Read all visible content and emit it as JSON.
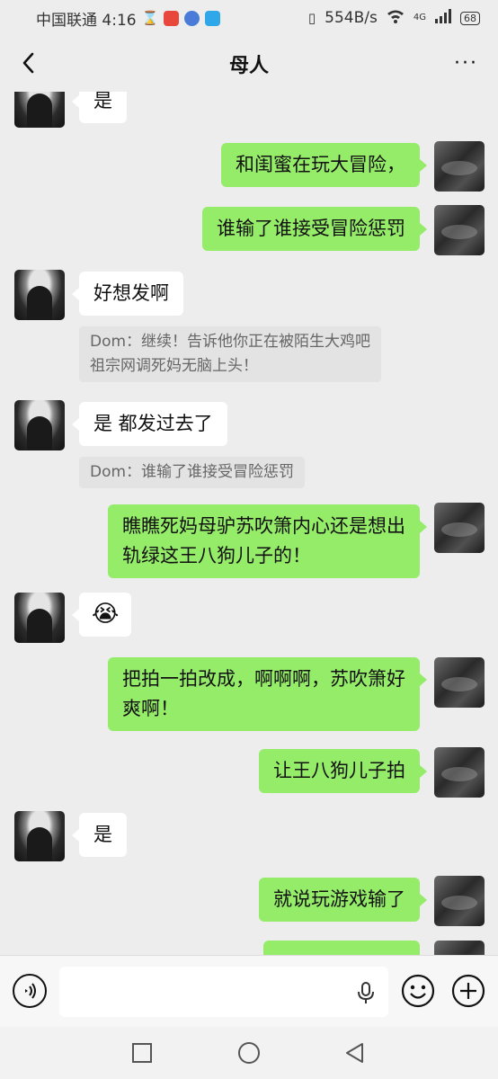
{
  "status": {
    "carrier_time": "中国联通 4:16",
    "speed": "554B/s",
    "network": "4G",
    "battery": "68"
  },
  "header": {
    "title": "母人"
  },
  "messages": [
    {
      "side": "left",
      "text": "是"
    },
    {
      "side": "right",
      "text": "和闺蜜在玩大冒险，"
    },
    {
      "side": "right",
      "text": "谁输了谁接受冒险惩罚"
    },
    {
      "side": "left",
      "text": "好想发啊"
    },
    {
      "quote_line1": "Dom：继续！告诉他你正在被陌生大鸡吧",
      "quote_line2": "祖宗网调死妈无脑上头！"
    },
    {
      "side": "left",
      "text": "是 都发过去了"
    },
    {
      "quote_line1": "Dom：谁输了谁接受冒险惩罚"
    },
    {
      "side": "right",
      "line1": "瞧瞧死妈母驴苏吹箫内心还是想出",
      "line2": "轨绿这王八狗儿子的！"
    },
    {
      "side": "left",
      "text": "😭"
    },
    {
      "side": "right",
      "line1": "把拍一拍改成，啊啊啊，苏吹箫好",
      "line2": "爽啊！"
    },
    {
      "side": "right",
      "text": "让王八狗儿子拍"
    },
    {
      "side": "left",
      "text": "是"
    },
    {
      "side": "right",
      "text": "就说玩游戏输了"
    }
  ],
  "icons": {
    "back": "chevron-left-icon",
    "more": "more-dots-icon",
    "voice": "voice-icon",
    "mic": "mic-icon",
    "emoji": "emoji-icon",
    "plus": "plus-icon"
  },
  "colors": {
    "sent_bubble": "#95ec69",
    "received_bubble": "#ffffff",
    "background": "#ededed"
  }
}
